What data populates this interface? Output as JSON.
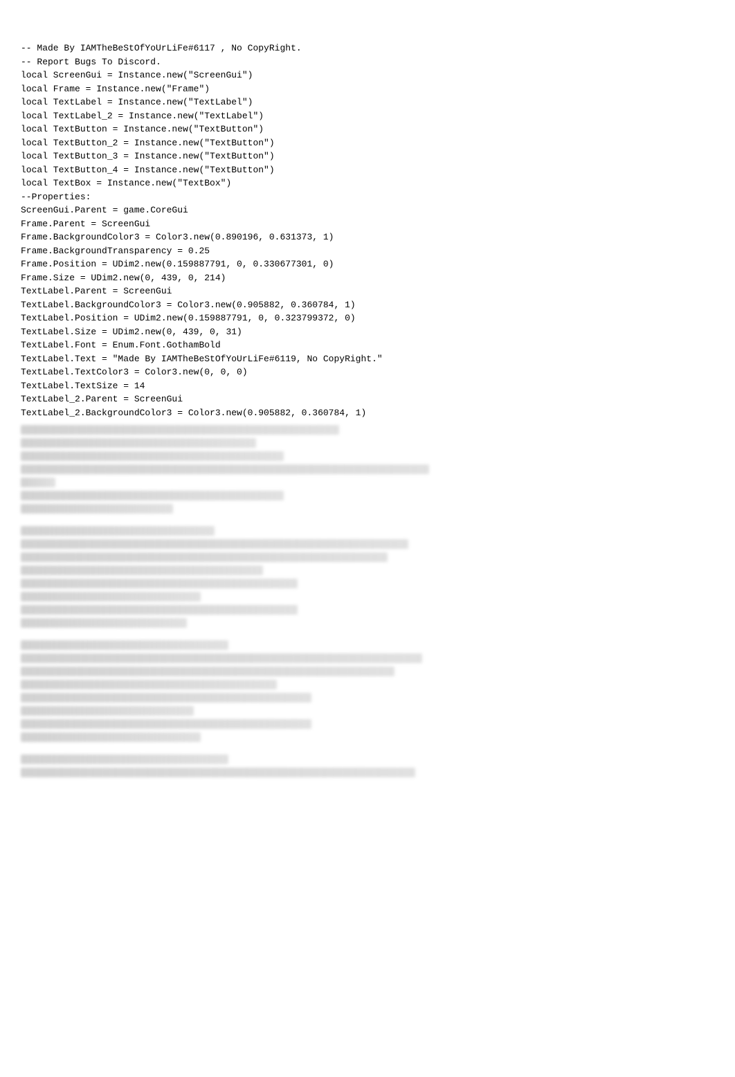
{
  "code": {
    "lines": [
      "-- Made By IAMTheBeStOfYoUrLiFe#6117 , No CopyRight.",
      "-- Report Bugs To Discord.",
      "local ScreenGui = Instance.new(\"ScreenGui\")",
      "local Frame = Instance.new(\"Frame\")",
      "local TextLabel = Instance.new(\"TextLabel\")",
      "local TextLabel_2 = Instance.new(\"TextLabel\")",
      "local TextButton = Instance.new(\"TextButton\")",
      "local TextButton_2 = Instance.new(\"TextButton\")",
      "local TextButton_3 = Instance.new(\"TextButton\")",
      "local TextButton_4 = Instance.new(\"TextButton\")",
      "local TextBox = Instance.new(\"TextBox\")",
      "--Properties:",
      "ScreenGui.Parent = game.CoreGui",
      "",
      "Frame.Parent = ScreenGui",
      "Frame.BackgroundColor3 = Color3.new(0.890196, 0.631373, 1)",
      "Frame.BackgroundTransparency = 0.25",
      "Frame.Position = UDim2.new(0.159887791, 0, 0.330677301, 0)",
      "Frame.Size = UDim2.new(0, 439, 0, 214)",
      "",
      "TextLabel.Parent = ScreenGui",
      "TextLabel.BackgroundColor3 = Color3.new(0.905882, 0.360784, 1)",
      "TextLabel.Position = UDim2.new(0.159887791, 0, 0.323799372, 0)",
      "TextLabel.Size = UDim2.new(0, 439, 0, 31)",
      "TextLabel.Font = Enum.Font.GothamBold",
      "TextLabel.Text = \"Made By IAMTheBeStOfYoUrLiFe#6119, No CopyRight.\"",
      "TextLabel.TextColor3 = Color3.new(0, 0, 0)",
      "TextLabel.TextSize = 14",
      "",
      "TextLabel_2.Parent = ScreenGui",
      "TextLabel_2.BackgroundColor3 = Color3.new(0.905882, 0.360784, 1)"
    ]
  }
}
